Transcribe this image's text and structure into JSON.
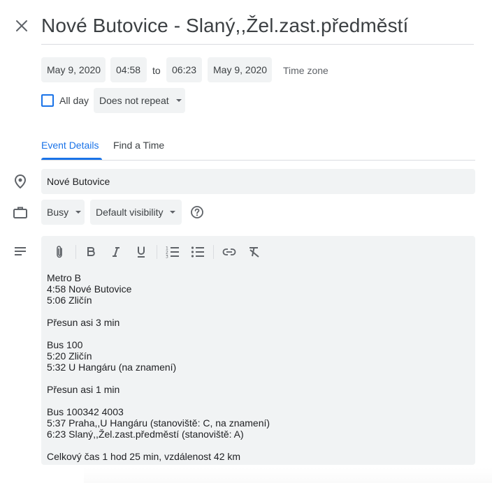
{
  "event": {
    "title": "Nové Butovice - Slaný,,Žel.zast.předměstí",
    "start_date": "May 9, 2020",
    "start_time": "04:58",
    "to_label": "to",
    "end_time": "06:23",
    "end_date": "May 9, 2020",
    "time_zone_label": "Time zone",
    "all_day_label": "All day",
    "repeat_value": "Does not repeat"
  },
  "tabs": [
    {
      "label": "Event Details",
      "active": true
    },
    {
      "label": "Find a Time",
      "active": false
    }
  ],
  "location": "Nové Butovice",
  "status": {
    "availability": "Busy",
    "visibility": "Default visibility"
  },
  "description": {
    "lines": [
      "Metro B",
      "4:58 Nové Butovice",
      "5:06 Zličín",
      "",
      "Přesun asi 3 min",
      "",
      "Bus 100",
      "5:20 Zličín",
      "5:32 U Hangáru (na znamení)",
      "",
      "Přesun asi 1 min",
      "",
      "Bus 100342 4003",
      "5:37 Praha,,U Hangáru (stanoviště: C, na znamení)",
      "6:23 Slaný,,Žel.zast.předměstí (stanoviště: A)",
      "",
      "Celkový čas 1 hod 25 min, vzdálenost 42 km"
    ]
  },
  "colors": {
    "accent": "#1a73e8",
    "field_bg": "#f1f3f4",
    "text": "#3c4043",
    "icon": "#5f6368"
  }
}
